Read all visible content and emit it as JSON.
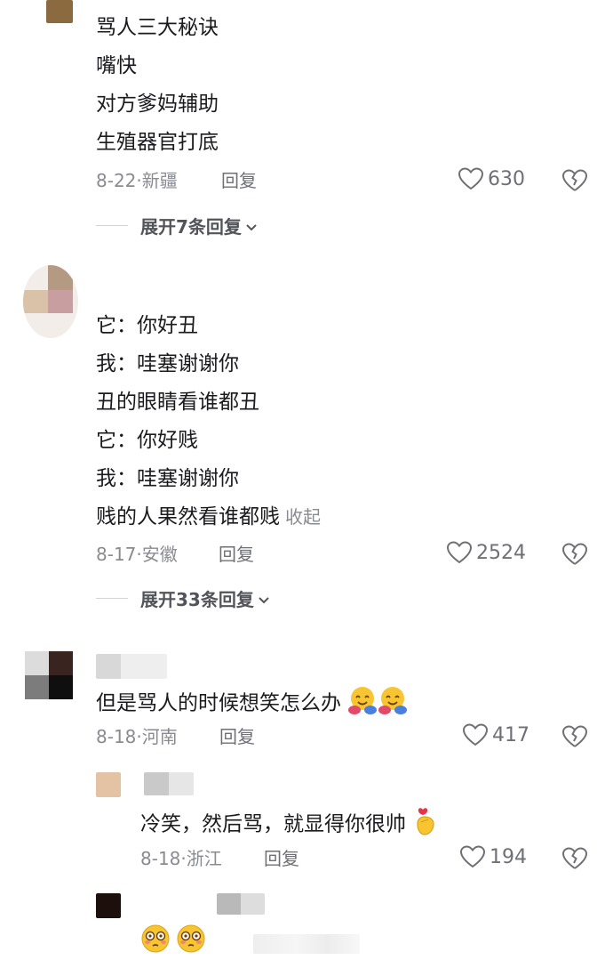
{
  "comments": [
    {
      "lines": [
        "骂人三大秘诀",
        "嘴快",
        "对方爹妈辅助",
        "生殖器官打底"
      ],
      "date": "8-22",
      "location": "新疆",
      "reply_label": "回复",
      "likes": "630",
      "expand_label": "展开7条回复"
    },
    {
      "lines": [
        "它：你好丑",
        "我：哇塞谢谢你",
        "丑的眼睛看谁都丑",
        "它：你好贱",
        "我：哇塞谢谢你",
        "贱的人果然看谁都贱"
      ],
      "collapse_label": "收起",
      "date": "8-17",
      "location": "安徽",
      "reply_label": "回复",
      "likes": "2524",
      "expand_label": "展开33条回复"
    },
    {
      "text": "但是骂人的时候想笑怎么办",
      "emoji": [
        "hugging-face-icon",
        "hugging-face-icon"
      ],
      "date": "8-18",
      "location": "河南",
      "reply_label": "回复",
      "likes": "417",
      "replies": [
        {
          "text": "冷笑，然后骂，就显得你很帅",
          "emoji": [
            "finger-heart-icon"
          ],
          "date": "8-18",
          "location": "浙江",
          "reply_label": "回复",
          "likes": "194"
        },
        {
          "emoji": [
            "flushed-face-icon",
            "flushed-face-icon"
          ]
        }
      ]
    }
  ],
  "colors": {
    "text": "#1b1b1f",
    "meta": "#8a8b91",
    "icon": "#6f7075",
    "emoji_yellow": "#f7c531"
  }
}
